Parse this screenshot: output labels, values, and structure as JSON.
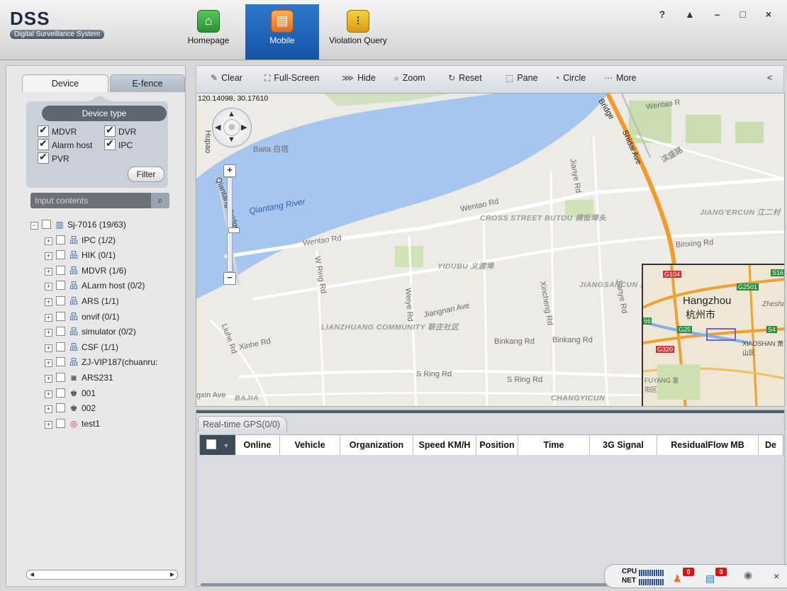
{
  "app": {
    "title": "DSS",
    "subtitle": "Digital Surveillance System",
    "window_controls": "? ▲ – □ ×"
  },
  "nav": [
    {
      "label": "Homepage",
      "icon": "home-icon"
    },
    {
      "label": "Mobile",
      "icon": "bus-icon",
      "active": true
    },
    {
      "label": "Violation Query",
      "icon": "traffic-light-icon"
    }
  ],
  "left": {
    "tabs": {
      "device": "Device",
      "efence": "E-fence"
    },
    "device_type_label": "Device type",
    "checkboxes": [
      {
        "label": "MDVR",
        "checked": true
      },
      {
        "label": "DVR",
        "checked": true
      },
      {
        "label": "Alarm host",
        "checked": true
      },
      {
        "label": "IPC",
        "checked": true
      },
      {
        "label": "PVR",
        "checked": true
      }
    ],
    "filter_button": "Filter",
    "search_placeholder": "Input contents",
    "tree": [
      {
        "label": "Sj-7016 (19/63)",
        "level": 0,
        "expanded": true,
        "icon": "server-icon"
      },
      {
        "label": "IPC (1/2)",
        "level": 1,
        "icon": "org-icon"
      },
      {
        "label": "HIK (0/1)",
        "level": 1,
        "icon": "org-icon"
      },
      {
        "label": "MDVR (1/6)",
        "level": 1,
        "icon": "org-icon"
      },
      {
        "label": "ALarm host (0/2)",
        "level": 1,
        "icon": "org-icon"
      },
      {
        "label": "ARS (1/1)",
        "level": 1,
        "icon": "org-icon"
      },
      {
        "label": "onvif (0/1)",
        "level": 1,
        "icon": "org-icon"
      },
      {
        "label": "simulator (0/2)",
        "level": 1,
        "icon": "org-icon"
      },
      {
        "label": "CSF (1/1)",
        "level": 1,
        "icon": "org-icon"
      },
      {
        "label": "ZJ-VIP187(chuanru:",
        "level": 1,
        "icon": "org-icon"
      },
      {
        "label": "ARS231",
        "level": 1,
        "icon": "ars-device-icon"
      },
      {
        "label": "001",
        "level": 1,
        "icon": "person-icon"
      },
      {
        "label": "002",
        "level": 1,
        "icon": "person-icon"
      },
      {
        "label": "test1",
        "level": 1,
        "icon": "test-device-icon"
      }
    ]
  },
  "toolbar": {
    "clear": "Clear",
    "fullscreen": "Full-Screen",
    "hide": "Hide",
    "zoom": "Zoom",
    "reset": "Reset",
    "pane": "Pane",
    "circle": "Circle",
    "more": "More",
    "collapse": "<"
  },
  "map": {
    "coords": "120.14098, 30.17610",
    "labels": {
      "river": "Qiantang River",
      "baita": "Baita 白塔",
      "wentao1": "Wentao Rd",
      "wentao2": "Wentao Rd",
      "wentao3": "Wentao R",
      "bridge": "Bridge",
      "shidai": "Shidai Ave",
      "jianye1": "Jianye Rd",
      "jianye2": "Jianye Rd",
      "crossstreet": "CROSS STREET BUTOU 横街埠头",
      "yidubu": "YIDUBU 义渡埠",
      "jiangercun": "JIANG'ERCUN 江二村",
      "binxing": "Binxing Rd",
      "wring": "W Ring Rd",
      "weiye": "Weiye Rd",
      "jiangnan": "Jiangnan Ave",
      "xincheng": "Xincheng Rd",
      "jiangsancun": "JIANGSANCUN 江三村",
      "lianzhuang": "LIANZHUANG COMMUNITY 联庄社区",
      "xinhe": "Xinhe Rd",
      "liuhe": "Liuhe Rd",
      "binkang1": "Binkang Rd",
      "binkang2": "Binkang Rd",
      "sring1": "S Ring Rd",
      "sring2": "S Ring Rd",
      "gxin": "gxin Ave",
      "bajia": "BAJIA",
      "changyicun": "CHANGYICUN",
      "qiantangbridge": "Qiantang Bridge",
      "hupao": "Hupao",
      "binjiang": "滨盛路"
    },
    "overview": {
      "city": "Hangzhou",
      "city_cn": "杭州市",
      "xiaoshan": "XIAOSHAN 萧山区",
      "zhesha": "Zhesha",
      "fuyang": "FUYANG 富阳区",
      "shields": [
        "G104",
        "G2501",
        "S16",
        "G25",
        "S4",
        "G320",
        "56"
      ]
    }
  },
  "gps": {
    "tab": "Real-time GPS(0/0)",
    "columns": [
      "Online",
      "Vehicle",
      "Organization",
      "Speed KM/H",
      "Position",
      "Time",
      "3G Signal",
      "ResidualFlow MB",
      "De"
    ]
  },
  "status": {
    "cpu": "CPU",
    "net": "NET",
    "alarm_count": "0",
    "msg_count": "0",
    "close": "×"
  }
}
